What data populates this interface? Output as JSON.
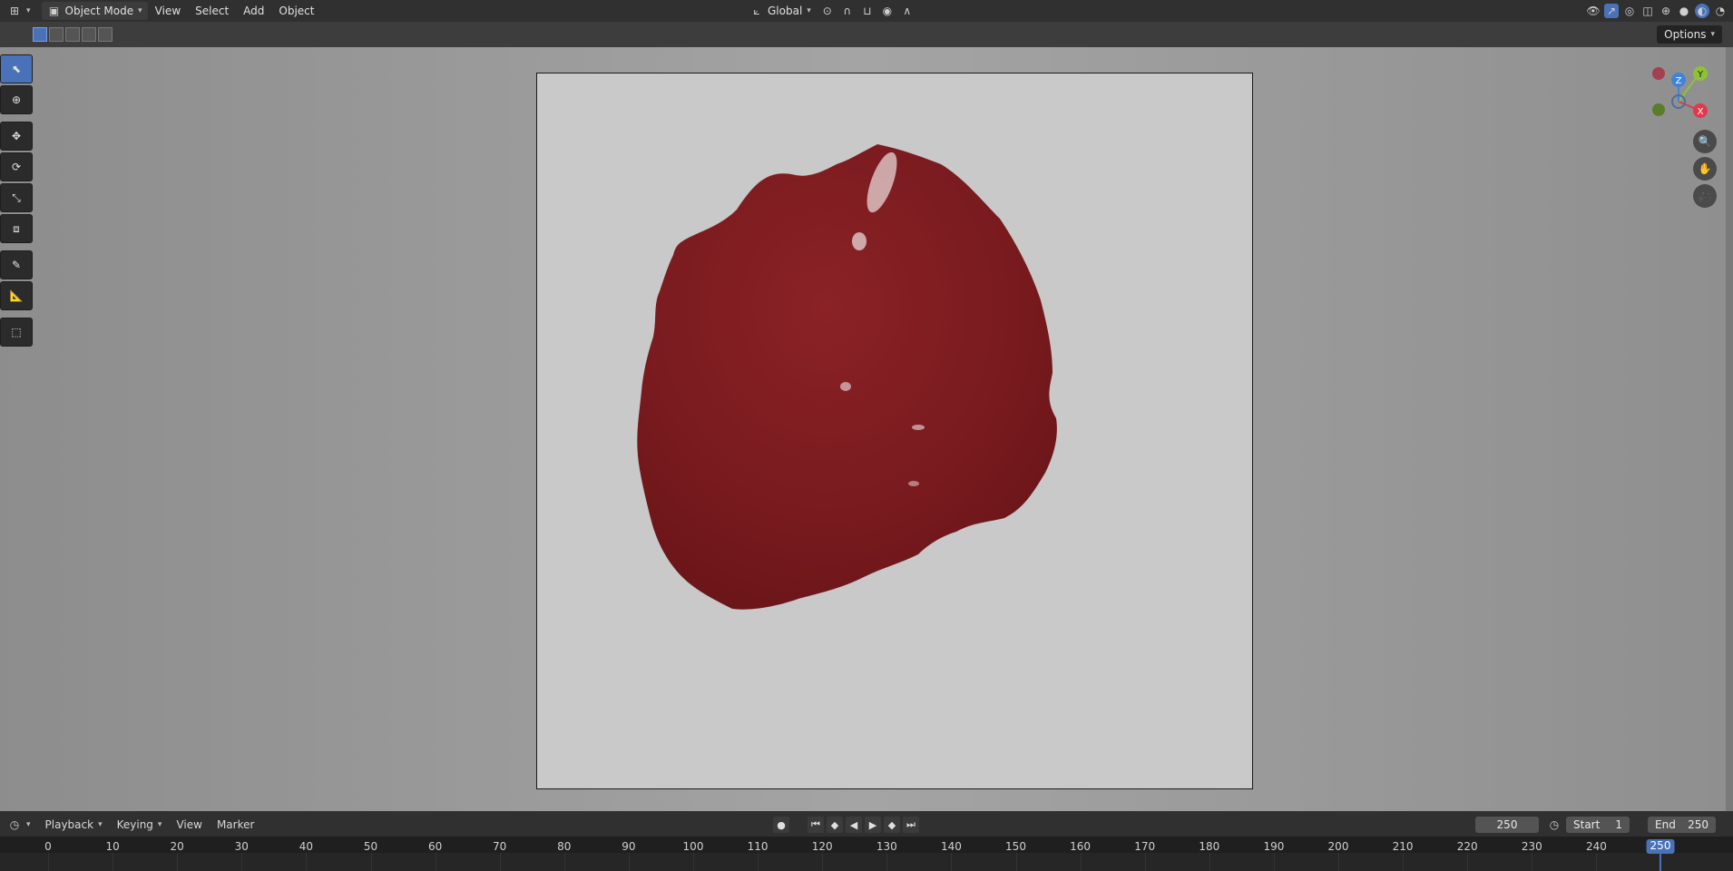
{
  "header": {
    "mode": "Object Mode",
    "menus": [
      "View",
      "Select",
      "Add",
      "Object"
    ],
    "orientation": "Global"
  },
  "tool_header": {
    "options_label": "Options"
  },
  "timeline": {
    "menus": [
      "Playback",
      "Keying",
      "View",
      "Marker"
    ],
    "current_frame": "250",
    "start_label": "Start",
    "start_value": "1",
    "end_label": "End",
    "end_value": "250",
    "ruler_ticks": [
      "0",
      "10",
      "20",
      "30",
      "40",
      "50",
      "60",
      "70",
      "80",
      "90",
      "100",
      "110",
      "120",
      "130",
      "140",
      "150",
      "160",
      "170",
      "180",
      "190",
      "200",
      "210",
      "220",
      "230",
      "240"
    ],
    "ruler_current": "250"
  },
  "gizmo": {
    "axis_x": "X",
    "axis_y": "Y",
    "axis_z": "Z"
  },
  "colors": {
    "accent": "#4a72b8",
    "object": "#7d1c1f",
    "axis_x": "#e0394d",
    "axis_y": "#8ec236",
    "axis_z": "#3f84d8"
  }
}
